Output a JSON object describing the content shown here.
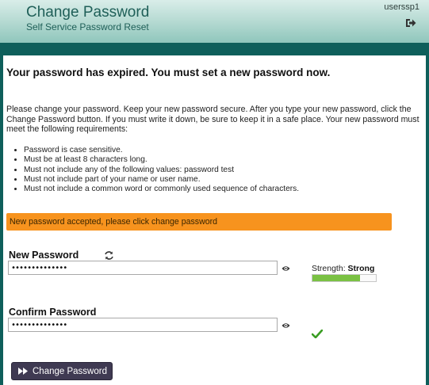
{
  "header": {
    "title": "Change Password",
    "subtitle": "Self Service Password Reset",
    "username": "userssp1",
    "logout_icon": "sign-out-icon"
  },
  "main": {
    "heading": "Your password has expired. You must set a new password now.",
    "instructions": "Please change your password. Keep your new password secure. After you type your new password, click the Change Password button. If you must write it down, be sure to keep it in a safe place. Your new password must meet the following requirements:",
    "requirements": [
      "Password is case sensitive.",
      "Must be at least 8 characters long.",
      "Must not include any of the following values: password test",
      "Must not include part of your name or user name.",
      "Must not include a common word or commonly used sequence of characters."
    ],
    "alert": "New password accepted, please click change password",
    "alert_color": "#f7931e"
  },
  "form": {
    "new_password": {
      "label": "New Password",
      "value": "••••••••••••••",
      "generate_icon": "refresh-icon",
      "show_icon": "eye-icon"
    },
    "strength": {
      "label": "Strength:",
      "value": "Strong",
      "level_fraction": 0.75,
      "color": "#7ac143"
    },
    "confirm_password": {
      "label": "Confirm Password",
      "value": "••••••••••••••",
      "show_icon": "eye-icon",
      "match_icon": "check-icon"
    },
    "submit_label": "Change Password",
    "submit_icon": "fast-forward-icon"
  }
}
